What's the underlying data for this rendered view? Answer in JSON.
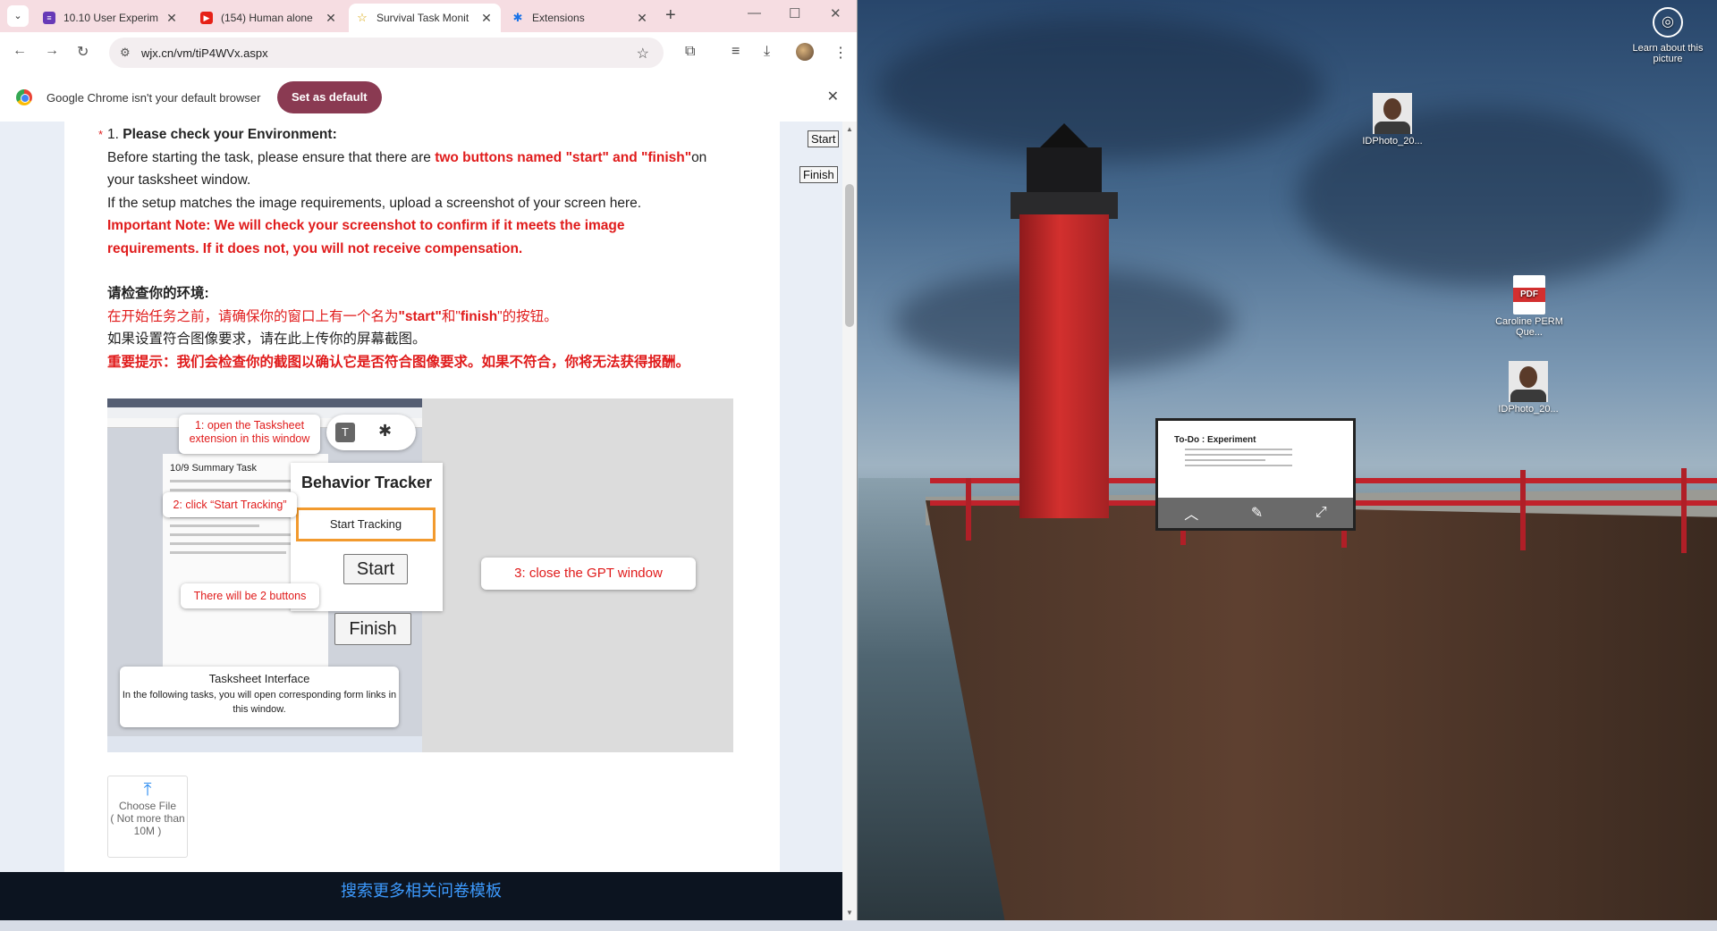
{
  "tabs": [
    {
      "title": "10.10 User Experim",
      "color": "#673ab7",
      "glyph": "≡"
    },
    {
      "title": "(154) Human alone",
      "color": "#e62117",
      "glyph": "▶"
    },
    {
      "title": "Survival Task Monit",
      "color": "#ffffff",
      "glyph": "☆"
    },
    {
      "title": "Extensions",
      "color": "#1a73e8",
      "glyph": "✱"
    }
  ],
  "address": {
    "url": "wjx.cn/vm/tiP4WVx.aspx"
  },
  "infobar": {
    "message": "Google Chrome isn't your default browser",
    "button": "Set as default"
  },
  "side_buttons": {
    "start": "Start",
    "finish": "Finish"
  },
  "question": {
    "required_mark": "*",
    "number": "1.",
    "title": "Please check your Environment:",
    "en_line1_pre": "Before starting the task, please ensure that there are ",
    "en_line1_red": "two buttons named \"start\" and \"finish\"",
    "en_line1_post": "on your tasksheet window.",
    "en_line2": "If the setup matches the image requirements, upload a screenshot of your screen here.",
    "en_note": "Important Note: We will check your screenshot to confirm if it meets the image requirements. If it does not, you will not receive compensation.",
    "cn_title": "请检查你的环境:",
    "cn_line1_a": "在开始任务之前，请确保你的窗口上有一个名为",
    "cn_line1_b": "\"start\"",
    "cn_line1_c": "和\"",
    "cn_line1_d": "finish",
    "cn_line1_e": "\"的按钮。",
    "cn_line2": "如果设置符合图像要求，请在此上传你的屏幕截图。",
    "cn_note": "重要提示：我们会检查你的截图以确认它是否符合图像要求。如果不符合，你将无法获得报酬。"
  },
  "guide": {
    "callout1": "1: open the Tasksheet extension in this window",
    "callout2": "2: click “Start Tracking”",
    "callout3": "3: close the GPT window",
    "callout4": "There will be 2 buttons",
    "behavior_title": "Behavior Tracker",
    "start_tracking": "Start Tracking",
    "start": "Start",
    "finish": "Finish",
    "sheet_title": "10/9 Summary Task",
    "ext_letter": "T",
    "interface_title": "Tasksheet Interface",
    "interface_desc": "In the following tasks, you will open corresponding form links in this window."
  },
  "upload": {
    "label": "Choose File",
    "limit": "( Not more than 10M )"
  },
  "footer": {
    "link": "搜索更多相关问卷模板"
  },
  "desktop": {
    "learn": "Learn about this picture",
    "icons": [
      {
        "label": "IDPhoto_20..."
      },
      {
        "label": "Caroline PERM Que...",
        "badge": "PDF"
      },
      {
        "label": "IDPhoto_20..."
      }
    ],
    "mini_title": "To-Do : Experiment"
  }
}
